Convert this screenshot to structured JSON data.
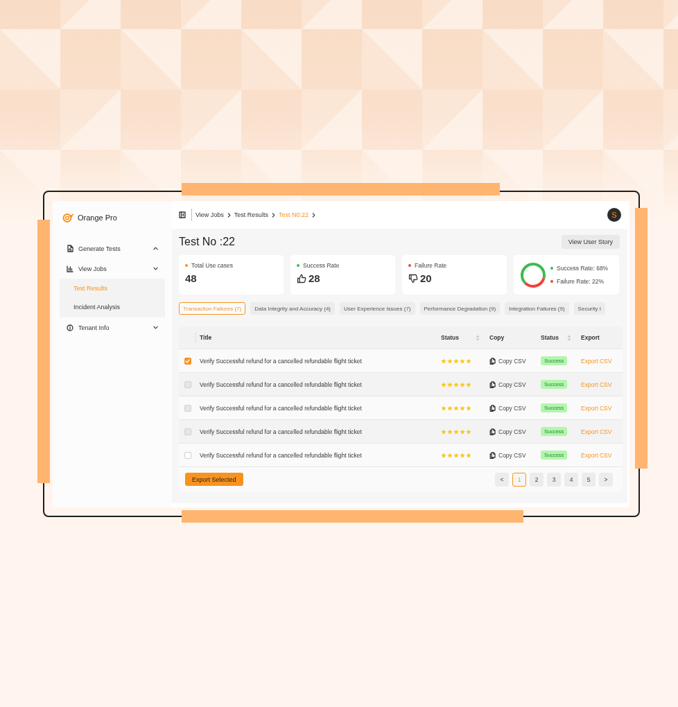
{
  "app": {
    "name": "Orange Pro"
  },
  "sidebar": {
    "items": [
      {
        "label": "Generate Tests",
        "expanded": true
      },
      {
        "label": "View Jobs",
        "expanded": false,
        "children": [
          {
            "label": "Test Results",
            "selected": true
          },
          {
            "label": "Incident Analysis",
            "selected": false
          }
        ]
      },
      {
        "label": "Tenant Info",
        "expanded": false
      }
    ]
  },
  "breadcrumb": [
    {
      "label": "View Jobs",
      "current": false
    },
    {
      "label": "Test Results",
      "current": false
    },
    {
      "label": "Test N0:22",
      "current": true
    }
  ],
  "user": {
    "initial": "S"
  },
  "page": {
    "title": "Test No :22",
    "action": "View User Story"
  },
  "stats": [
    {
      "label": "Total Use cases",
      "value": "48",
      "color": "#f7931e"
    },
    {
      "label": "Success Rate",
      "value": "28",
      "color": "#3dbb4f"
    },
    {
      "label": "Failure Rate",
      "value": "20",
      "color": "#f04438"
    }
  ],
  "summary": {
    "legend": [
      {
        "label": "Success Rate: 68%",
        "color": "#3dbb4f"
      },
      {
        "label": "Failure Rate: 22%",
        "color": "#f04438"
      }
    ]
  },
  "tabs": [
    {
      "label": "Transaction Failures (7)",
      "selected": true
    },
    {
      "label": "Data Integrity and Accuracy (4)",
      "selected": false
    },
    {
      "label": "User Experience Issues (7)",
      "selected": false
    },
    {
      "label": "Performance Degradation (9)",
      "selected": false
    },
    {
      "label": "Integration Failures (9)",
      "selected": false
    },
    {
      "label": "Security I",
      "selected": false
    }
  ],
  "table": {
    "columns": [
      {
        "label": "Title",
        "sortable": false
      },
      {
        "label": "Status",
        "sortable": true
      },
      {
        "label": "Copy",
        "sortable": false
      },
      {
        "label": "Status",
        "sortable": true
      },
      {
        "label": "Export",
        "sortable": false
      }
    ],
    "rows": [
      {
        "checked": true,
        "disabled": false,
        "title": "Verify Successful refund for a cancelled refundable flight ticket",
        "stars": 5,
        "copy": "Copy CSV",
        "status": "Success",
        "export": "Export CSV"
      },
      {
        "checked": false,
        "disabled": true,
        "title": "Verify Successful refund for a cancelled refundable flight ticket",
        "stars": 5,
        "copy": "Copy CSV",
        "status": "Success",
        "export": "Export CSV"
      },
      {
        "checked": false,
        "disabled": true,
        "title": "Verify Successful refund for a cancelled refundable flight ticket",
        "stars": 5,
        "copy": "Copy CSV",
        "status": "Success",
        "export": "Export CSV"
      },
      {
        "checked": false,
        "disabled": true,
        "title": "Verify Successful refund for a cancelled refundable flight ticket",
        "stars": 5,
        "copy": "Copy CSV",
        "status": "Success",
        "export": "Export CSV"
      },
      {
        "checked": false,
        "disabled": false,
        "title": "Verify Successful refund for a cancelled refundable flight ticket",
        "stars": 5,
        "copy": "Copy CSV",
        "status": "Success",
        "export": "Export CSV"
      }
    ]
  },
  "footer": {
    "action": "Export Selected"
  },
  "pagination": {
    "prev": "<",
    "next": ">",
    "pages": [
      {
        "label": "1",
        "selected": true
      },
      {
        "label": "2",
        "selected": false
      },
      {
        "label": "3",
        "selected": false
      },
      {
        "label": "4",
        "selected": false
      },
      {
        "label": "5",
        "selected": false
      }
    ]
  }
}
